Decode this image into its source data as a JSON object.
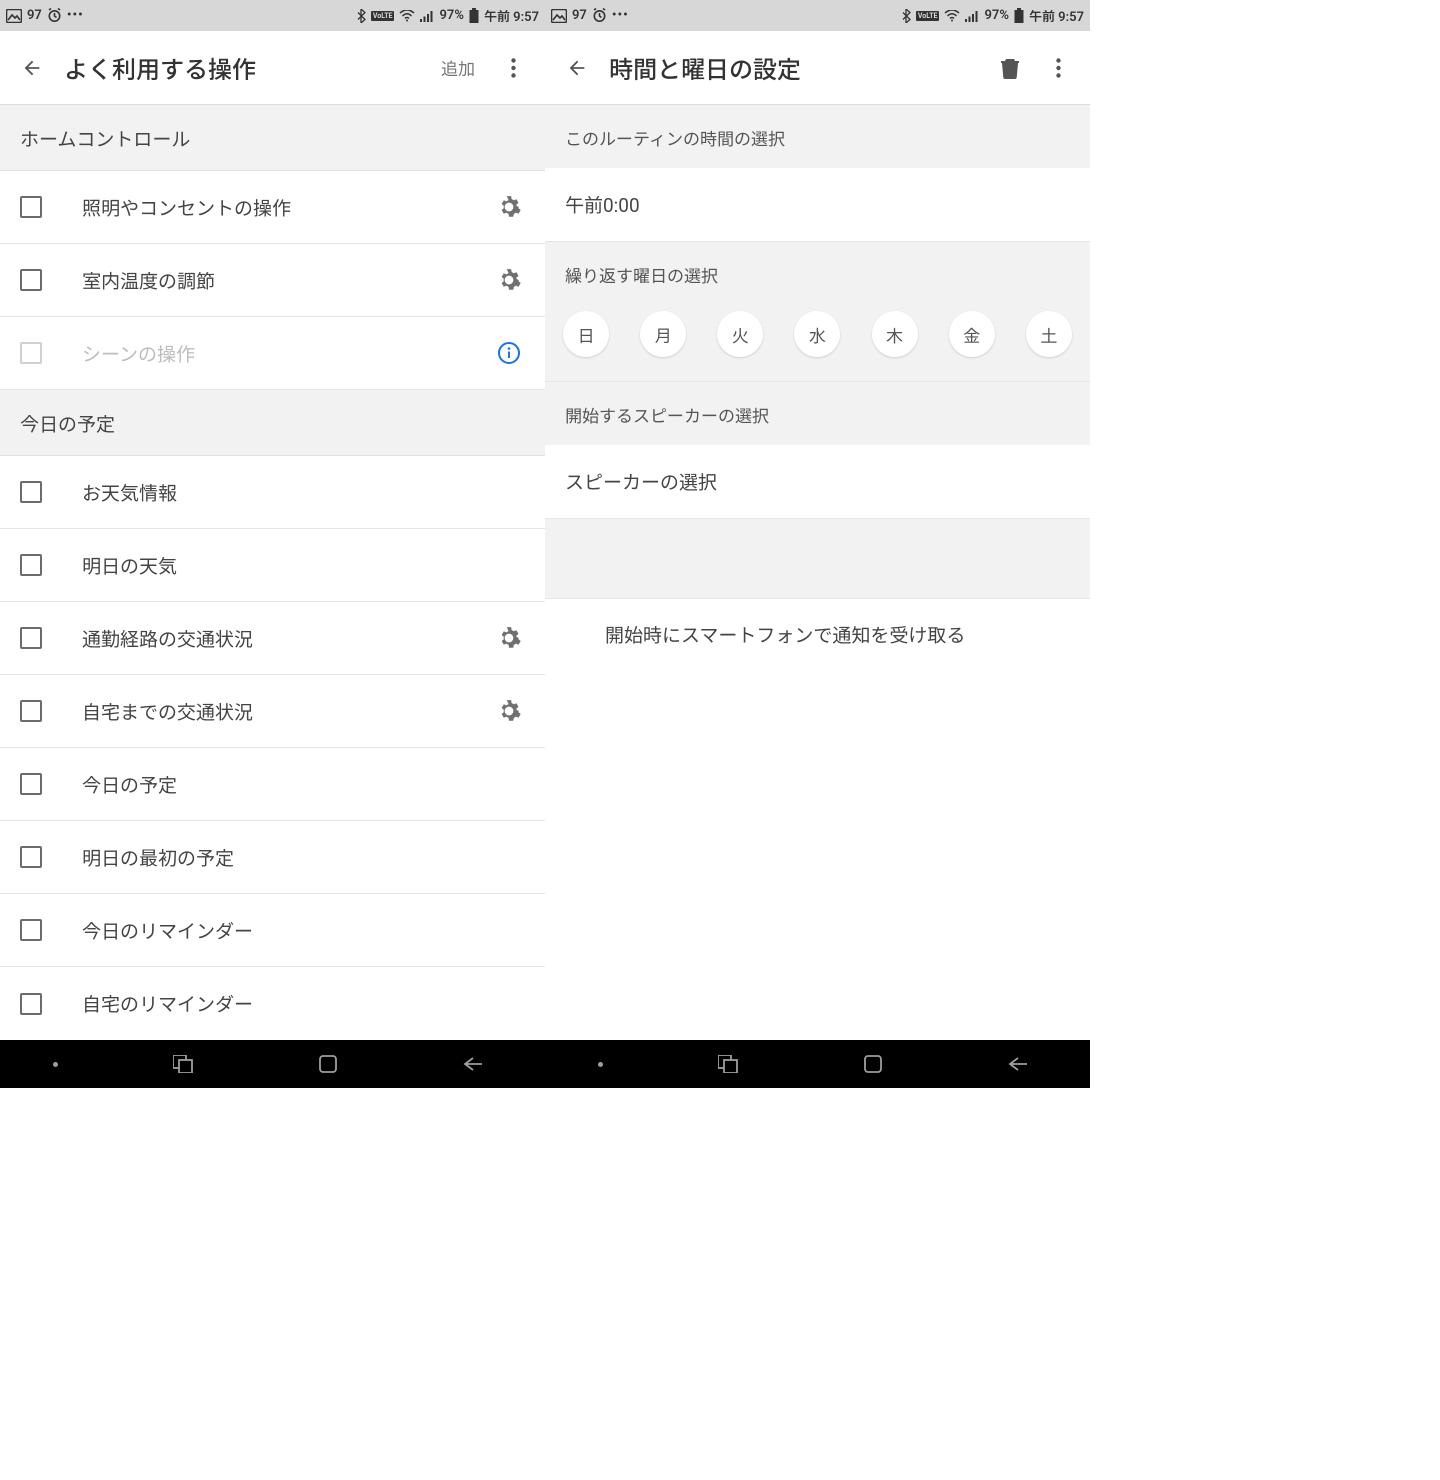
{
  "status": {
    "left_count": "97",
    "battery_pct": "97%",
    "time": "午前 9:57"
  },
  "left": {
    "title": "よく利用する操作",
    "add_label": "追加",
    "sections": {
      "home_control": "ホームコントロール",
      "today": "今日の予定"
    },
    "rows": {
      "lights": "照明やコンセントの操作",
      "temperature": "室内温度の調節",
      "scene": "シーンの操作",
      "weather": "お天気情報",
      "tomorrow_weather": "明日の天気",
      "commute": "通勤経路の交通状況",
      "home_traffic": "自宅までの交通状況",
      "today_schedule": "今日の予定",
      "tomorrow_first": "明日の最初の予定",
      "today_reminder": "今日のリマインダー",
      "home_reminder": "自宅のリマインダー"
    }
  },
  "right": {
    "title": "時間と曜日の設定",
    "time_section": "このルーティンの時間の選択",
    "time_value": "午前0:00",
    "repeat_section": "繰り返す曜日の選択",
    "days": [
      "日",
      "月",
      "火",
      "水",
      "木",
      "金",
      "土"
    ],
    "speaker_section": "開始するスピーカーの選択",
    "speaker_value": "スピーカーの選択",
    "notify_label": "開始時にスマートフォンで通知を受け取る"
  }
}
